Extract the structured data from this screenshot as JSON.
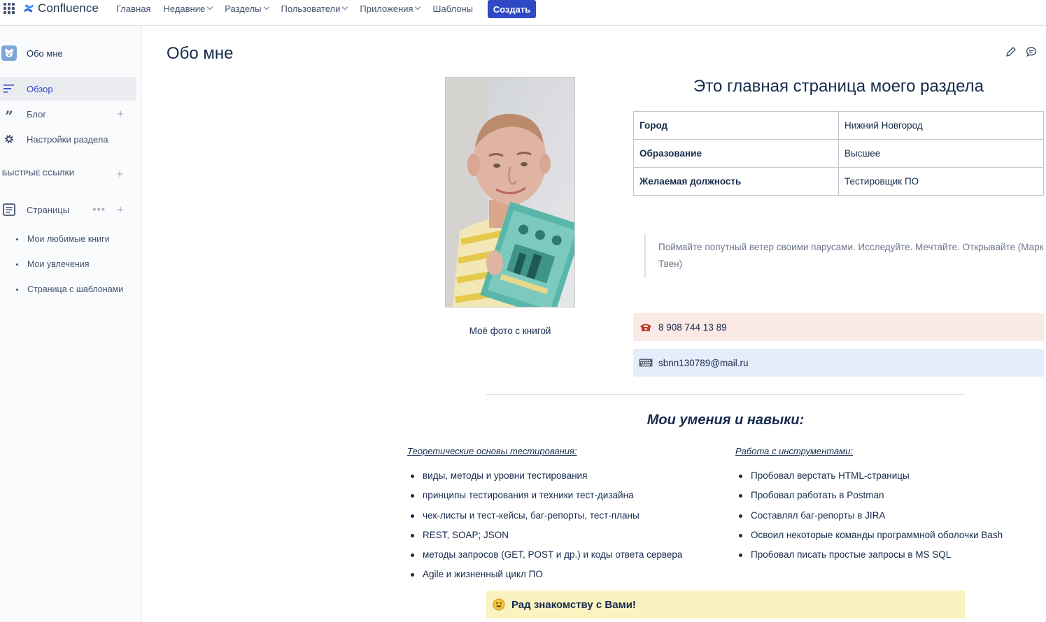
{
  "app": {
    "name": "Confluence"
  },
  "topnav": {
    "items": [
      {
        "label": "Главная",
        "dropdown": false
      },
      {
        "label": "Недавние",
        "dropdown": true
      },
      {
        "label": "Разделы",
        "dropdown": true
      },
      {
        "label": "Пользователи",
        "dropdown": true
      },
      {
        "label": "Приложения",
        "dropdown": true
      },
      {
        "label": "Шаблоны",
        "dropdown": false
      }
    ],
    "create_label": "Создать"
  },
  "sidebar": {
    "space_name": "Обо мне",
    "items": [
      {
        "label": "Обзор",
        "icon": "overview-icon",
        "active": true
      },
      {
        "label": "Блог",
        "icon": "quote-icon",
        "active": false
      },
      {
        "label": "Настройки раздела",
        "icon": "gear-icon",
        "active": false
      }
    ],
    "quick_links_label": "БЫСТРЫЕ ССЫЛКИ",
    "pages_label": "Страницы",
    "tree": [
      "Мои любимые книги",
      "Мои увлечения",
      "Страница с шаблонами"
    ]
  },
  "page": {
    "title": "Обо мне",
    "photo_caption": "Моё фото с книгой",
    "heading": "Это главная страница моего раздела",
    "info_table": [
      {
        "key": "Город",
        "value": "Нижний Новгород"
      },
      {
        "key": "Образование",
        "value": "Высшее"
      },
      {
        "key": "Желаемая должность",
        "value": "Тестировщик ПО"
      }
    ],
    "quote": "Поймайте попутный ветер своими парусами. Исследуйте. Мечтайте. Открывайте (Марк Твен)",
    "phone": "8 908 744 13 89",
    "email": "sbnn130789@mail.ru",
    "skills_heading": "Мои умения и навыки:",
    "theory_heading": "Теоретические основы тестирования:",
    "theory": [
      "виды, методы и уровни тестирования",
      "принципы тестирования и техники тест-дизайна",
      "чек-листы и тест-кейсы, баг-репорты, тест-планы",
      "REST, SOAP; JSON",
      "методы запросов (GET, POST и др.) и коды ответа сервера",
      "Agile и жизненный цикл ПО"
    ],
    "tools_heading": "Работа с инструментами:",
    "tools": [
      "Пробовал верстать HTML-страницы",
      "Пробовал работать в Postman",
      "Составлял баг-репорты в JIRA",
      "Освоил некоторые команды программной оболочки Bash",
      "Пробовал писать простые запросы в MS SQL"
    ],
    "greeting": "Рад знакомству с Вами!"
  },
  "colors": {
    "accent": "#2f49c5",
    "text": "#172b4d",
    "panel_red": "#fbe9e6",
    "panel_blue": "#e6ecfb",
    "panel_yellow": "#faf3c0"
  }
}
